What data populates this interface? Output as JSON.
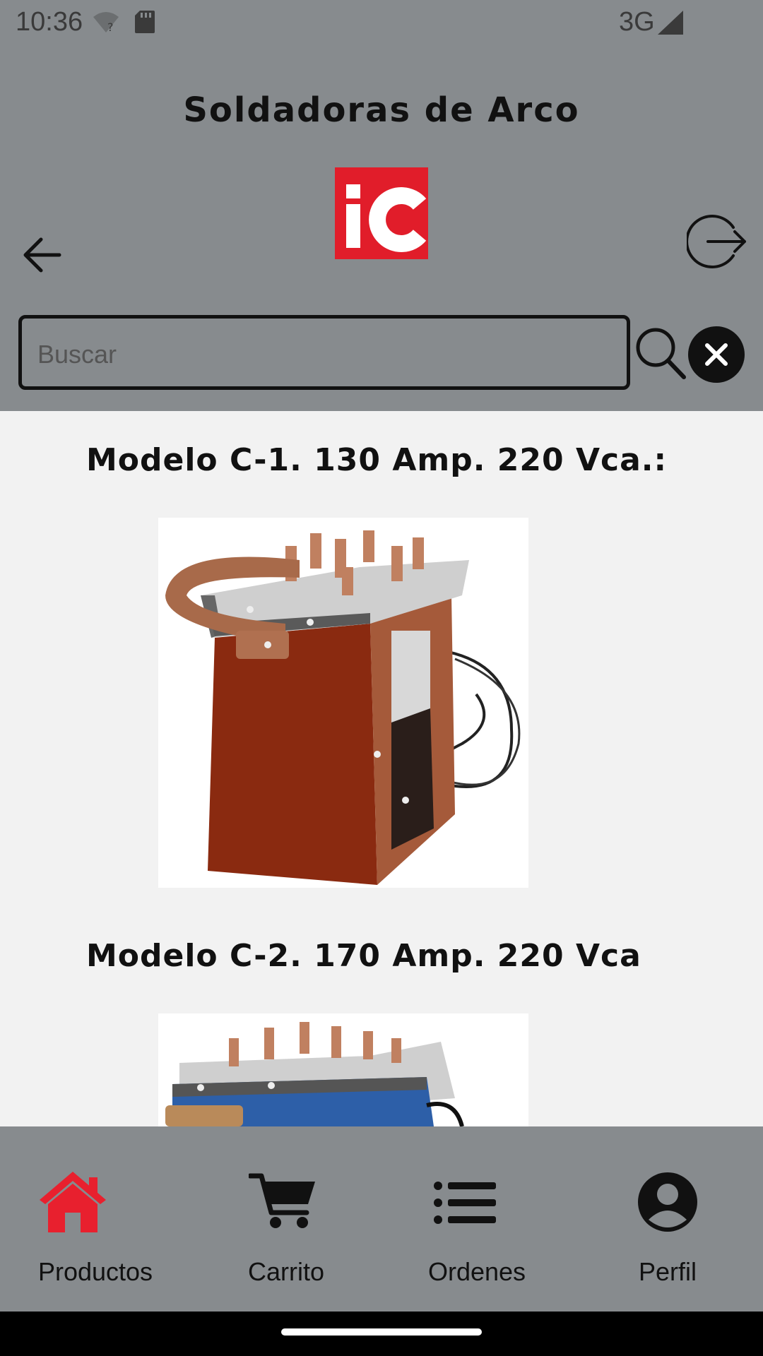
{
  "status_bar": {
    "time": "10:36",
    "network": "3G"
  },
  "header": {
    "title": "Soldadoras de Arco",
    "logo_text": "iC",
    "logo_color": "#e11d2a",
    "search": {
      "placeholder": "Buscar",
      "value": ""
    }
  },
  "products": [
    {
      "title": "Modelo C-1. 130 Amp. 220 Vca.:"
    },
    {
      "title": "Modelo C-2. 170 Amp. 220 Vca"
    }
  ],
  "bottom_nav": {
    "active_color": "#e8202e",
    "items": [
      {
        "label": "Productos",
        "icon": "home-icon",
        "active": true
      },
      {
        "label": "Carrito",
        "icon": "cart-icon",
        "active": false
      },
      {
        "label": "Ordenes",
        "icon": "list-icon",
        "active": false
      },
      {
        "label": "Perfil",
        "icon": "user-icon",
        "active": false
      }
    ]
  },
  "colors": {
    "header_bg": "#878b8e",
    "content_bg": "#f2f2f2"
  }
}
